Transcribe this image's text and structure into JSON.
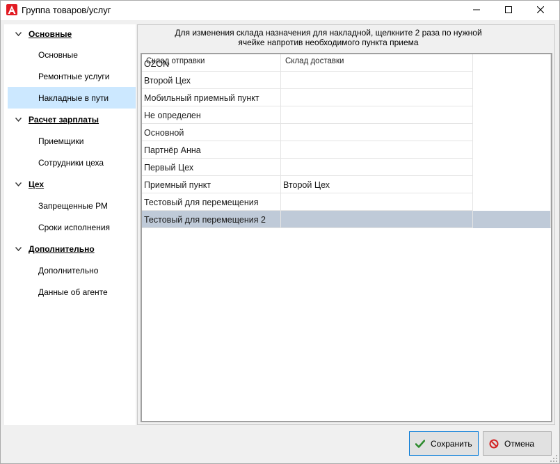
{
  "window": {
    "title": "Группа товаров/услуг"
  },
  "sidebar": {
    "items": [
      {
        "label": "Основные",
        "kind": "group",
        "expanded": true
      },
      {
        "label": "Основные",
        "kind": "child"
      },
      {
        "label": "Ремонтные услуги",
        "kind": "child"
      },
      {
        "label": "Накладные в пути",
        "kind": "child",
        "selected": true
      },
      {
        "label": "Расчет зарплаты",
        "kind": "group",
        "expanded": true
      },
      {
        "label": "Приемщики",
        "kind": "child"
      },
      {
        "label": "Сотрудники цеха",
        "kind": "child"
      },
      {
        "label": "Цех",
        "kind": "group",
        "expanded": true
      },
      {
        "label": "Запрещенные РМ",
        "kind": "child"
      },
      {
        "label": "Сроки исполнения",
        "kind": "child"
      },
      {
        "label": "Дополнительно",
        "kind": "group",
        "expanded": true
      },
      {
        "label": "Дополнительно",
        "kind": "child"
      },
      {
        "label": "Данные об агенте",
        "kind": "child"
      }
    ]
  },
  "main": {
    "instruction_line1": "Для изменения склада назначения для накладной, щелкните 2 раза по нужной",
    "instruction_line2": "ячейке напротив необходимого пункта приема",
    "columns": [
      "Склад отправки",
      "Склад доставки"
    ],
    "rows": [
      {
        "from": "OZON",
        "to": ""
      },
      {
        "from": "Второй Цех",
        "to": ""
      },
      {
        "from": "Мобильный приемный пункт",
        "to": ""
      },
      {
        "from": "Не определен",
        "to": ""
      },
      {
        "from": "Основной",
        "to": ""
      },
      {
        "from": "Партнёр Анна",
        "to": ""
      },
      {
        "from": "Первый Цех",
        "to": ""
      },
      {
        "from": "Приемный пункт",
        "to": "Второй Цех"
      },
      {
        "from": "Тестовый для перемещения",
        "to": ""
      },
      {
        "from": "Тестовый для перемещения 2",
        "to": "",
        "selected": true
      }
    ]
  },
  "footer": {
    "save_label": "Сохранить",
    "cancel_label": "Отмена"
  },
  "icons": {
    "app": "app-logo-icon",
    "minimize": "minimize-icon",
    "maximize": "maximize-icon",
    "close": "close-icon",
    "chevron": "chevron-down-icon",
    "save": "checkmark-icon",
    "cancel": "prohibited-icon"
  },
  "colors": {
    "selected_nav": "#cce8ff",
    "selected_row": "#bfcad8",
    "save_icon": "#2e8b2e",
    "cancel_icon": "#d32020",
    "app_icon": "#e21b23"
  }
}
